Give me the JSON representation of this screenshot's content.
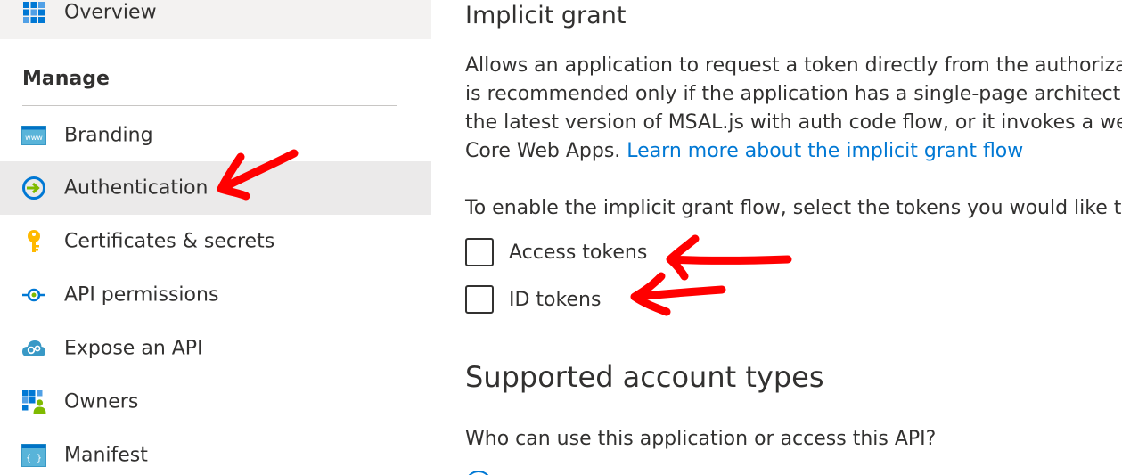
{
  "sidebar": {
    "overview": {
      "label": "Overview",
      "icon": "overview-grid-icon"
    },
    "manage_header": "Manage",
    "items": [
      {
        "label": "Branding",
        "icon": "branding-www-icon"
      },
      {
        "label": "Authentication",
        "icon": "authentication-icon",
        "selected": true
      },
      {
        "label": "Certificates & secrets",
        "icon": "key-icon"
      },
      {
        "label": "API permissions",
        "icon": "api-permissions-icon"
      },
      {
        "label": "Expose an API",
        "icon": "cloud-gear-icon"
      },
      {
        "label": "Owners",
        "icon": "owners-icon"
      },
      {
        "label": "Manifest",
        "icon": "manifest-code-icon"
      }
    ]
  },
  "implicit_grant": {
    "title": "Implicit grant",
    "description_lines": [
      "Allows an application to request a token directly from the authorizat",
      "is recommended only if the application has a single-page architectu",
      "the latest version of MSAL.js with auth code flow, or it invokes a we",
      "Core Web Apps. "
    ],
    "learn_more_link": "Learn more about the implicit grant flow",
    "enable_prompt": "To enable the implicit grant flow, select the tokens you would like to",
    "tokens": [
      {
        "label": "Access tokens",
        "checked": false
      },
      {
        "label": "ID tokens",
        "checked": false
      }
    ]
  },
  "supported_accounts": {
    "title": "Supported account types",
    "question": "Who can use this application or access this API?"
  },
  "colors": {
    "accent": "#0078d4",
    "selected_bg": "#ebeaea",
    "annotation_arrow": "#ff0000"
  }
}
